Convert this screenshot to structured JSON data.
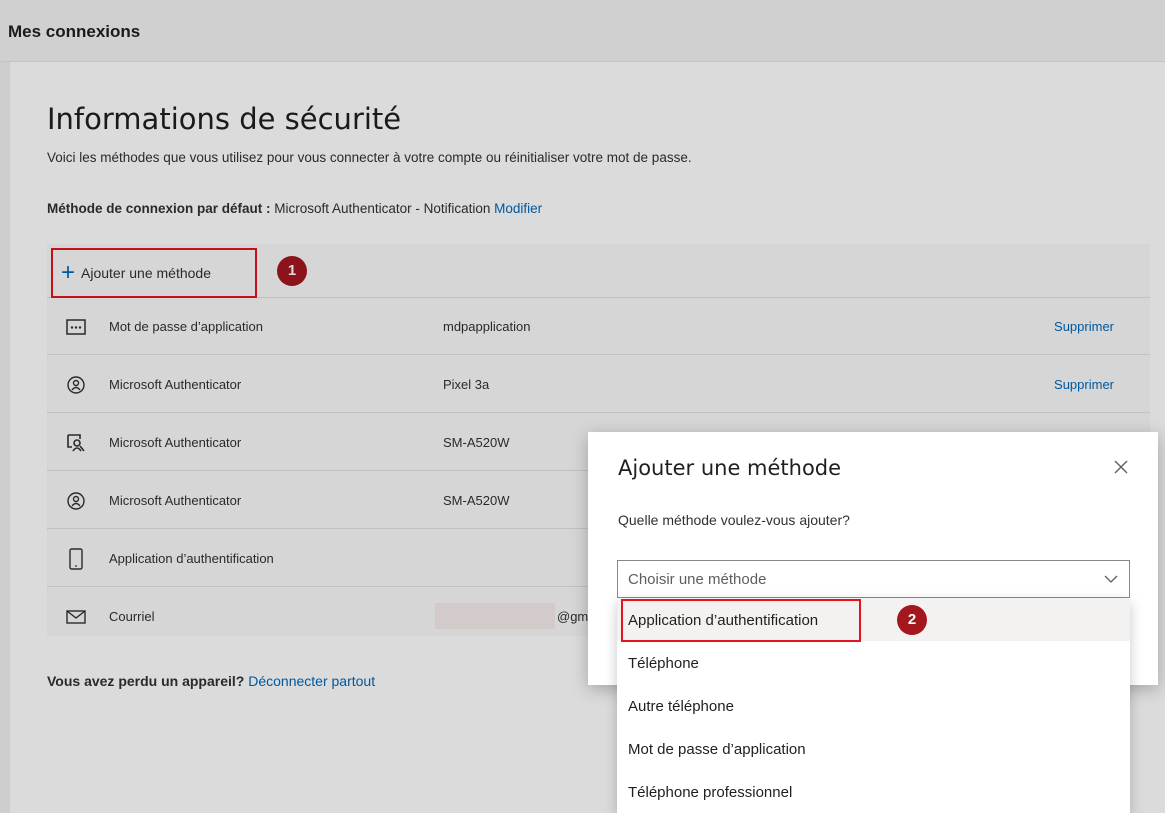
{
  "app": {
    "title": "Mes connexions"
  },
  "page": {
    "heading": "Informations de sécurité",
    "description": "Voici les méthodes que vous utilisez pour vous connecter à votre compte ou réinitialiser votre mot de passe.",
    "default_method_label": "Méthode de connexion par défaut :",
    "default_method_value": "Microsoft Authenticator - Notification",
    "default_method_link": "Modifier",
    "add_method_label": "Ajouter une méthode",
    "lost_device_label": "Vous avez perdu un appareil?",
    "lost_device_link": "Déconnecter partout"
  },
  "methods": [
    {
      "icon": "password-dots-icon",
      "name": "Mot de passe d’application",
      "detail": "mdpapplication",
      "action": "Supprimer"
    },
    {
      "icon": "authenticator-lock-icon",
      "name": "Microsoft Authenticator",
      "detail": "Pixel 3a",
      "action": "Supprimer"
    },
    {
      "icon": "authenticator-passwordless-icon",
      "name": "Microsoft Authenticator",
      "detail": "SM-A520W",
      "action": ""
    },
    {
      "icon": "authenticator-lock-icon",
      "name": "Microsoft Authenticator",
      "detail": "SM-A520W",
      "action": ""
    },
    {
      "icon": "phone-icon",
      "name": "Application d’authentification",
      "detail": "",
      "action": ""
    },
    {
      "icon": "mail-icon",
      "name": "Courriel",
      "detail": "@gm",
      "action": ""
    }
  ],
  "annotations": {
    "step1": "1",
    "step2": "2",
    "highlight_color": "#e3141d",
    "badge_color": "#a4171e"
  },
  "dialog": {
    "title": "Ajouter une méthode",
    "question": "Quelle méthode voulez-vous ajouter?",
    "select_placeholder": "Choisir une méthode",
    "options": [
      "Application d’authentification",
      "Téléphone",
      "Autre téléphone",
      "Mot de passe d’application",
      "Téléphone professionnel"
    ]
  },
  "colors": {
    "accent": "#0067b8"
  }
}
